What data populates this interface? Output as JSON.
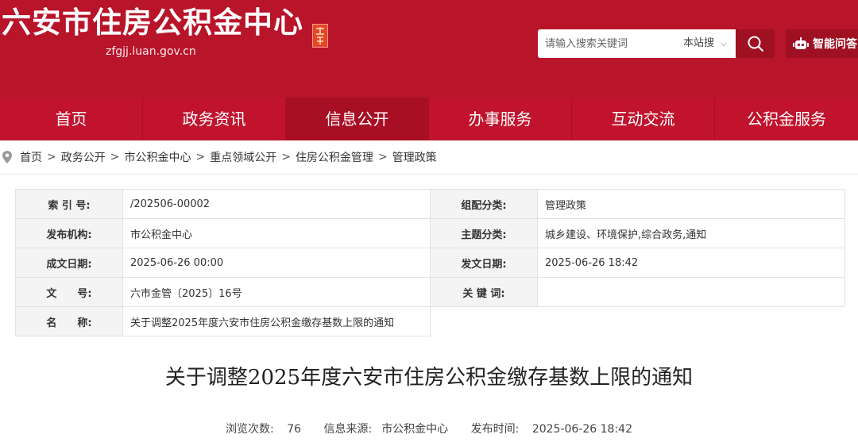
{
  "header": {
    "site_title": "六安市住房公积金中心",
    "domain": "zfgjj.luan.gov.cn",
    "search_placeholder": "请输入搜索关键词",
    "search_scope": "本站搜",
    "ai_label": "智能问答"
  },
  "nav": [
    "首页",
    "政务资讯",
    "信息公开",
    "办事服务",
    "互动交流",
    "公积金服务"
  ],
  "breadcrumb": [
    "首页",
    "政务公开",
    "市公积金中心",
    "重点领域公开",
    "住房公积金管理",
    "管理政策"
  ],
  "info": {
    "index_label": "索 引 号:",
    "index_value": "/202506-00002",
    "category_label": "组配分类:",
    "category_value": "管理政策",
    "publisher_label": "发布机构:",
    "publisher_value": "市公积金中心",
    "topic_label": "主题分类:",
    "topic_value": "城乡建设、环境保护,综合政务,通知",
    "created_label": "成文日期:",
    "created_value": "2025-06-26 00:00",
    "issued_label": "发文日期:",
    "issued_value": "2025-06-26 18:42",
    "docno_label": "文　　号:",
    "docno_value": "六市金管〔2025〕16号",
    "keywords_label": "关 键 词:",
    "keywords_value": "",
    "name_label": "名　　称:",
    "name_value": "关于调整2025年度六安市住房公积金缴存基数上限的通知"
  },
  "doc_title": "关于调整2025年度六安市住房公积金缴存基数上限的通知",
  "meta": {
    "views_label": "浏览次数:",
    "views_value": "76",
    "source_label": "信息来源:",
    "source_value": "市公积金中心",
    "time_label": "发布时间:",
    "time_value": "2025-06-26 18:42"
  },
  "colors": {
    "brand": "#b8142a",
    "nav": "#c1132d",
    "nav_active": "#a80f24"
  }
}
